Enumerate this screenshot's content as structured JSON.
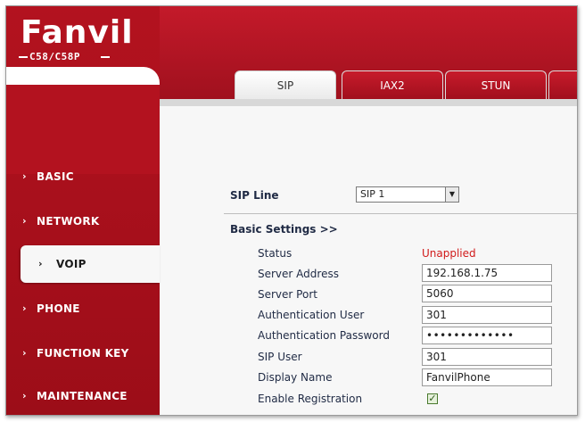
{
  "brand": {
    "logo": "Fanvil",
    "model": "C58/C58P"
  },
  "tabs": [
    {
      "label": "SIP",
      "active": true
    },
    {
      "label": "IAX2",
      "active": false
    },
    {
      "label": "STUN",
      "active": false
    }
  ],
  "sidebar": {
    "items": [
      {
        "label": "BASIC",
        "active": false
      },
      {
        "label": "NETWORK",
        "active": false
      },
      {
        "label": "VOIP",
        "active": true
      },
      {
        "label": "PHONE",
        "active": false
      },
      {
        "label": "FUNCTION KEY",
        "active": false
      },
      {
        "label": "MAINTENANCE",
        "active": false
      }
    ],
    "arrow": "›"
  },
  "sip_line": {
    "label": "SIP Line",
    "value": "SIP 1"
  },
  "section": {
    "title": "Basic Settings >>"
  },
  "fields": {
    "status": {
      "label": "Status",
      "value": "Unapplied"
    },
    "server_address": {
      "label": "Server Address",
      "value": "192.168.1.75"
    },
    "server_port": {
      "label": "Server Port",
      "value": "5060"
    },
    "auth_user": {
      "label": "Authentication User",
      "value": "301"
    },
    "auth_password": {
      "label": "Authentication Password",
      "value": "•••••••••••••"
    },
    "sip_user": {
      "label": "SIP User",
      "value": "301"
    },
    "display_name": {
      "label": "Display Name",
      "value": "FanvilPhone"
    },
    "enable_registration": {
      "label": "Enable Registration",
      "checked": true
    }
  },
  "colors": {
    "brand_red": "#b3121f",
    "status_red": "#d11b1b",
    "label_navy": "#1f2a44"
  }
}
